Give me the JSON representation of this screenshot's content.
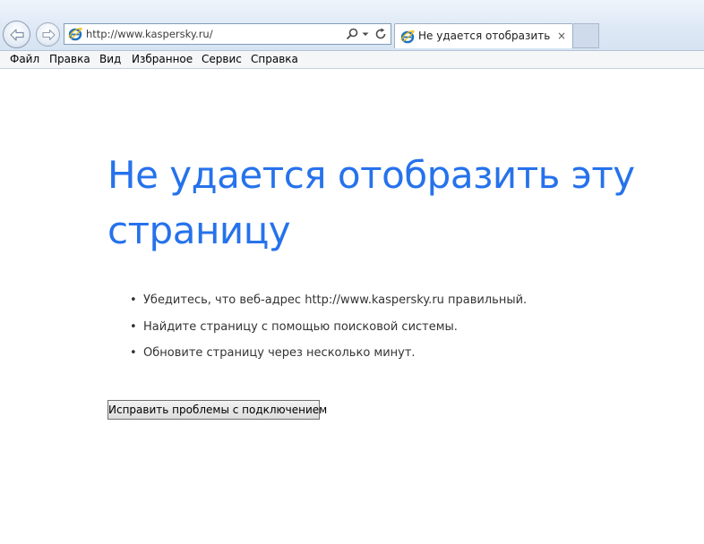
{
  "browser": {
    "address_url": "http://www.kaspersky.ru/",
    "tab_title": "Не удается отобразить эту...",
    "tab_close": "×",
    "icons": {
      "back": "back-arrow-icon",
      "forward": "forward-arrow-icon",
      "site": "ie-logo-icon",
      "search": "search-icon",
      "dropdown": "dropdown-arrow-icon",
      "refresh": "refresh-icon",
      "tab_site": "ie-logo-icon"
    },
    "colors": {
      "chrome": "#dbe7f4",
      "ie_blue": "#1e73be"
    }
  },
  "menu": [
    "Файл",
    "Правка",
    "Вид",
    "Избранное",
    "Сервис",
    "Справка"
  ],
  "page": {
    "heading_line1": "Не удается отобразить эту",
    "heading_line2": "страницу",
    "heading_color": "#2672ec",
    "tips": [
      "Убедитесь, что веб-адрес http://www.kaspersky.ru правильный.",
      "Найдите страницу с помощью поисковой системы.",
      "Обновите страницу через несколько минут."
    ],
    "bullet": "•",
    "fix_button": "Исправить проблемы с подключением"
  }
}
